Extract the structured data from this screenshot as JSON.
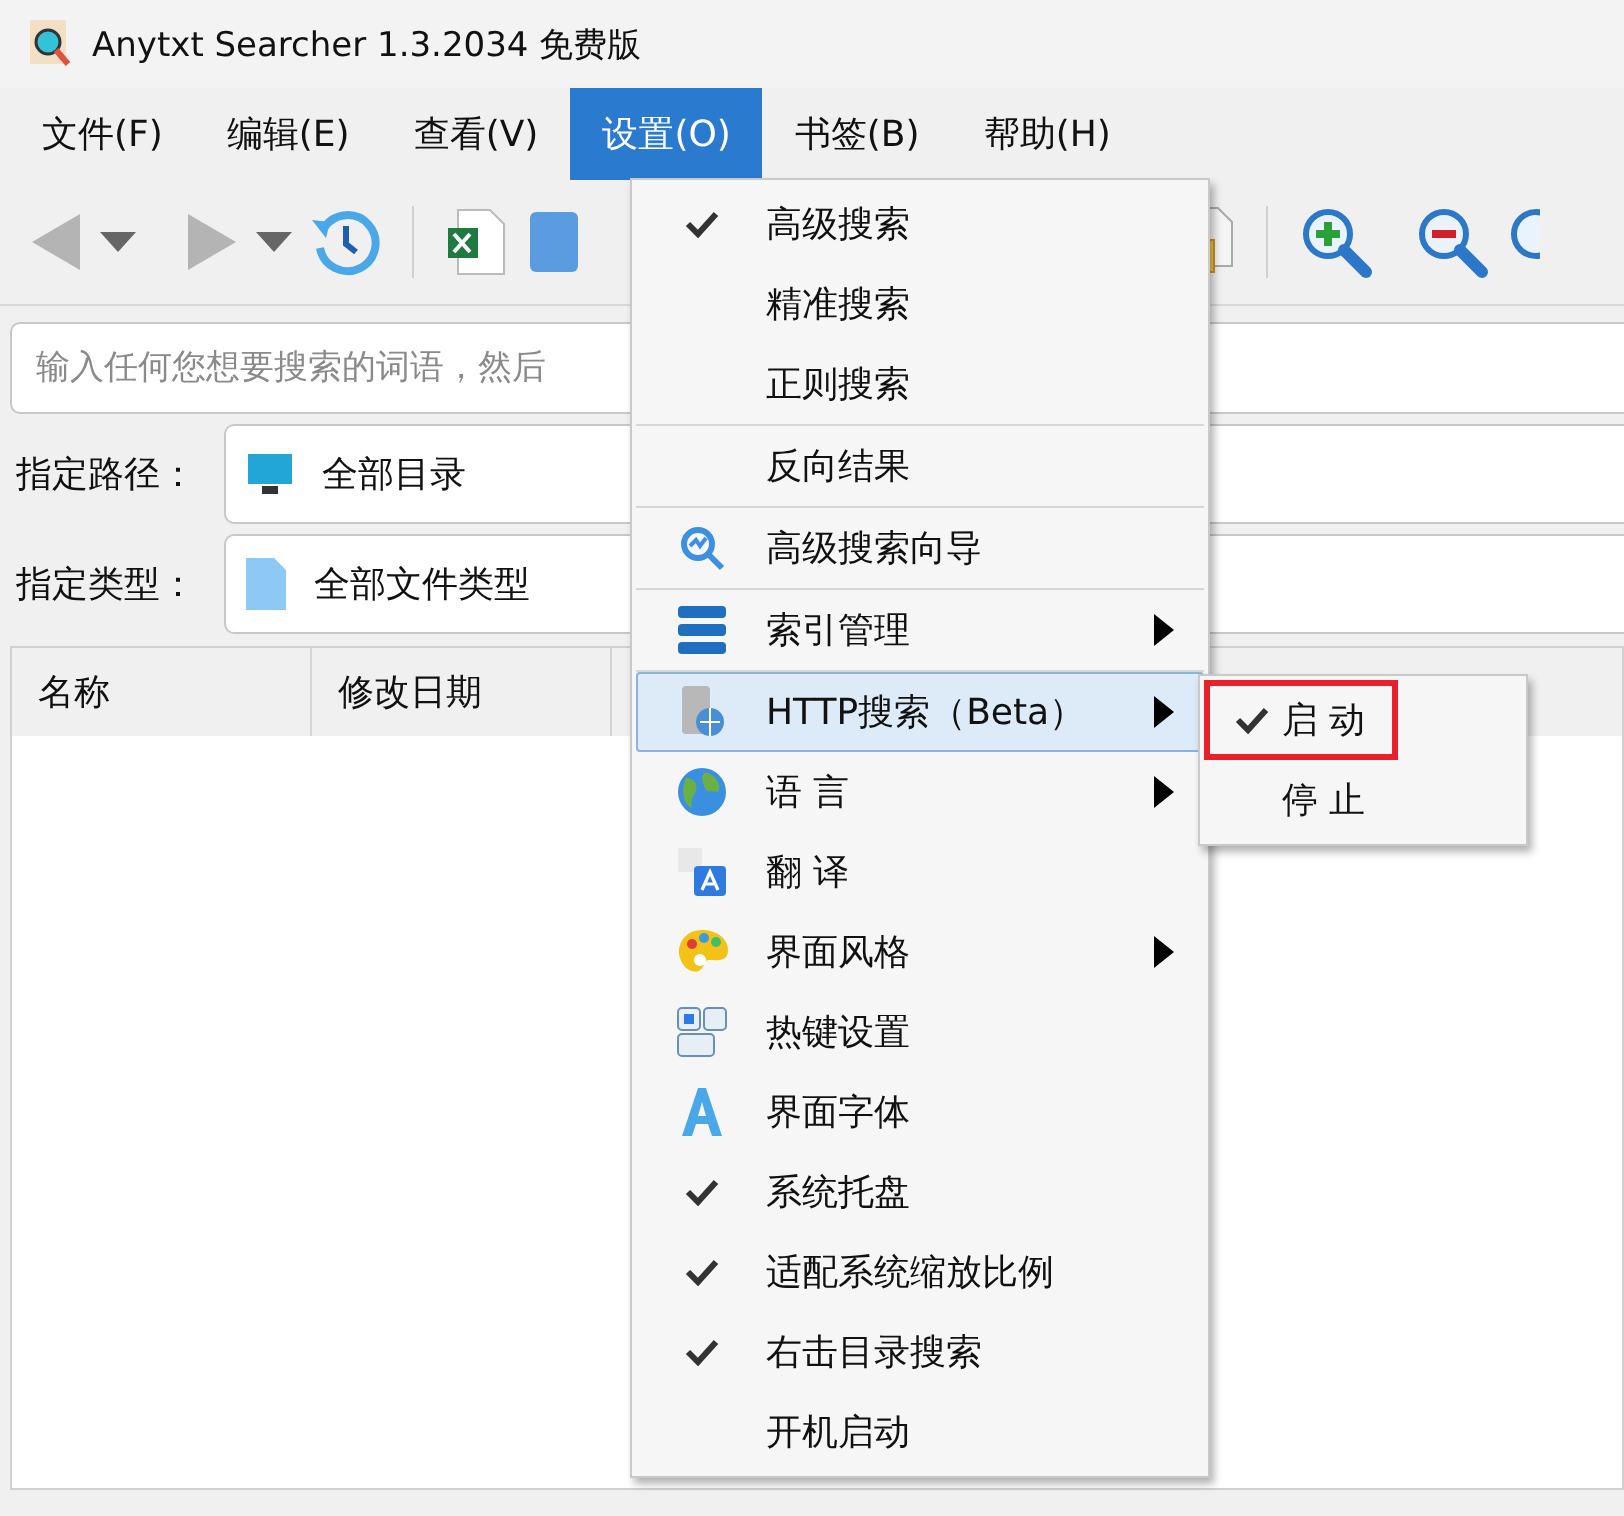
{
  "window": {
    "title": "Anytxt Searcher 1.3.2034 免费版"
  },
  "menubar": [
    {
      "label": "文件(F)",
      "selected": false
    },
    {
      "label": "编辑(E)",
      "selected": false
    },
    {
      "label": "查看(V)",
      "selected": false
    },
    {
      "label": "设置(O)",
      "selected": true
    },
    {
      "label": "书签(B)",
      "selected": false
    },
    {
      "label": "帮助(H)",
      "selected": false
    }
  ],
  "search": {
    "placeholder": "输入任何您想要搜索的词语，然后"
  },
  "filters": [
    {
      "label": "指定路径：",
      "value": "全部目录",
      "kind": "folder"
    },
    {
      "label": "指定类型：",
      "value": "全部文件类型",
      "kind": "file"
    }
  ],
  "table": {
    "columns": [
      "名称",
      "修改日期"
    ]
  },
  "settings_menu": {
    "groups": [
      [
        {
          "label": "高级搜索",
          "kind": "check",
          "checked": true,
          "submenu": false,
          "selected": false
        },
        {
          "label": "精准搜索",
          "kind": "check",
          "checked": false,
          "submenu": false,
          "selected": false
        },
        {
          "label": "正则搜索",
          "kind": "check",
          "checked": false,
          "submenu": false,
          "selected": false
        }
      ],
      [
        {
          "label": "反向结果",
          "kind": "check",
          "checked": false,
          "submenu": false,
          "selected": false
        }
      ],
      [
        {
          "label": "高级搜索向导",
          "kind": "wizard",
          "submenu": false,
          "selected": false
        }
      ],
      [
        {
          "label": "索引管理",
          "kind": "index",
          "submenu": true,
          "selected": false
        }
      ],
      [
        {
          "label": "HTTP搜索（Beta）",
          "kind": "server",
          "submenu": true,
          "selected": true
        },
        {
          "label": "语 言",
          "kind": "globe",
          "submenu": true,
          "selected": false
        },
        {
          "label": "翻 译",
          "kind": "translate",
          "submenu": false,
          "selected": false
        },
        {
          "label": "界面风格",
          "kind": "palette",
          "submenu": true,
          "selected": false
        },
        {
          "label": "热键设置",
          "kind": "hotkey",
          "submenu": false,
          "selected": false
        },
        {
          "label": "界面字体",
          "kind": "font",
          "submenu": false,
          "selected": false
        },
        {
          "label": "系统托盘",
          "kind": "check",
          "checked": true,
          "submenu": false,
          "selected": false
        },
        {
          "label": "适配系统缩放比例",
          "kind": "check",
          "checked": true,
          "submenu": false,
          "selected": false
        },
        {
          "label": "右击目录搜索",
          "kind": "check",
          "checked": true,
          "submenu": false,
          "selected": false
        },
        {
          "label": "开机启动",
          "kind": "check",
          "checked": false,
          "submenu": false,
          "selected": false
        }
      ]
    ]
  },
  "http_submenu": {
    "items": [
      {
        "label": "启 动",
        "checked": true,
        "outlined": true
      },
      {
        "label": "停 止",
        "checked": false,
        "outlined": false
      }
    ]
  }
}
